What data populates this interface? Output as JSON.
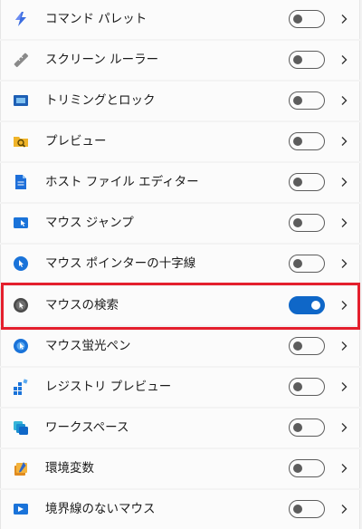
{
  "items": [
    {
      "label": "コマンド パレット",
      "icon": "command-palette-icon",
      "enabled": false
    },
    {
      "label": "スクリーン ルーラー",
      "icon": "screen-ruler-icon",
      "enabled": false
    },
    {
      "label": "トリミングとロック",
      "icon": "crop-and-lock-icon",
      "enabled": false
    },
    {
      "label": "プレビュー",
      "icon": "peek-preview-icon",
      "enabled": false
    },
    {
      "label": "ホスト ファイル エディター",
      "icon": "hosts-file-editor-icon",
      "enabled": false
    },
    {
      "label": "マウス ジャンプ",
      "icon": "mouse-jump-icon",
      "enabled": false
    },
    {
      "label": "マウス ポインターの十字線",
      "icon": "mouse-crosshairs-icon",
      "enabled": false
    },
    {
      "label": "マウスの検索",
      "icon": "find-my-mouse-icon",
      "enabled": true
    },
    {
      "label": "マウス蛍光ペン",
      "icon": "mouse-highlighter-icon",
      "enabled": false
    },
    {
      "label": "レジストリ プレビュー",
      "icon": "registry-preview-icon",
      "enabled": false
    },
    {
      "label": "ワークスペース",
      "icon": "workspaces-icon",
      "enabled": false
    },
    {
      "label": "環境変数",
      "icon": "environment-variables-icon",
      "enabled": false
    },
    {
      "label": "境界線のないマウス",
      "icon": "mouse-without-borders-icon",
      "enabled": false
    }
  ],
  "highlighted_item": "マウスの検索",
  "colors": {
    "toggle_on": "#0f67c8",
    "toggle_off_border": "#5c5c5c",
    "highlight_border": "#e41f2d",
    "row_background": "#fbfbfb"
  }
}
